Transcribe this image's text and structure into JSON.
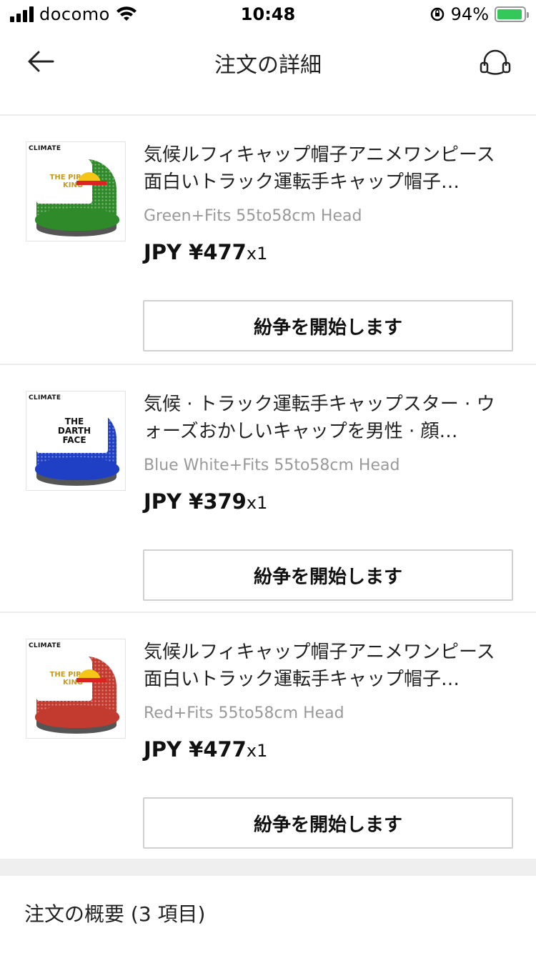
{
  "status_bar": {
    "carrier": "docomo",
    "time": "10:48",
    "battery": "94%",
    "battery_level": 0.94,
    "icons": [
      "signal-icon",
      "wifi-icon",
      "orientation-lock-icon",
      "battery-charging-icon"
    ]
  },
  "header": {
    "title": "注文の詳細",
    "back_icon": "arrow-left-icon",
    "support_icon": "headset-icon"
  },
  "items": [
    {
      "title": "気候ルフィキャップ帽子アニメワンピース面白いトラック運転手キャップ帽子…",
      "variant": "Green+Fits 55to58cm Head",
      "price": "JPY ¥477",
      "quantity": "x1",
      "button": "紛争を開始します",
      "thumb_brand": "CLIMATE",
      "thumb_logo": "THE PIRATE KING",
      "cap_color": "#2f8a2a"
    },
    {
      "title": "気候 · トラック運転手キャップスター · ウォーズおかしいキャップを男性 · 顔…",
      "variant": "Blue White+Fits 55to58cm Head",
      "price": "JPY ¥379",
      "quantity": "x1",
      "button": "紛争を開始します",
      "thumb_brand": "CLIMATE",
      "thumb_logo": "THE DARTH FACE",
      "cap_color": "#1f3fc4"
    },
    {
      "title": "気候ルフィキャップ帽子アニメワンピース面白いトラック運転手キャップ帽子…",
      "variant": "Red+Fits 55to58cm Head",
      "price": "JPY ¥477",
      "quantity": "x1",
      "button": "紛争を開始します",
      "thumb_brand": "CLIMATE",
      "thumb_logo": "THE PIRATE KING",
      "cap_color": "#c33a2f"
    }
  ],
  "summary": {
    "title": "注文の概要 (3 項目)"
  }
}
